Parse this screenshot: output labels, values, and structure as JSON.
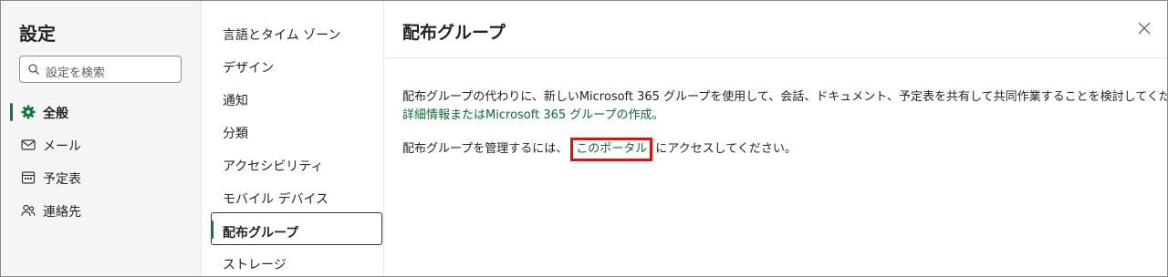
{
  "sidebar": {
    "title": "設定",
    "search_placeholder": "設定を検索",
    "items": [
      {
        "label": "全般",
        "icon": "gear-icon",
        "active": true
      },
      {
        "label": "メール",
        "icon": "mail-icon"
      },
      {
        "label": "予定表",
        "icon": "calendar-icon"
      },
      {
        "label": "連絡先",
        "icon": "people-icon"
      }
    ]
  },
  "subnav": {
    "items": [
      {
        "label": "言語とタイム ゾーン"
      },
      {
        "label": "デザイン"
      },
      {
        "label": "通知"
      },
      {
        "label": "分類"
      },
      {
        "label": "アクセシビリティ"
      },
      {
        "label": "モバイル デバイス"
      },
      {
        "label": "配布グループ",
        "active": true
      },
      {
        "label": "ストレージ"
      }
    ]
  },
  "content": {
    "title": "配布グループ",
    "para1": "配布グループの代わりに、新しいMicrosoft 365 グループを使用して、会話、ドキュメント、予定表を共有して共同作業することを検討してください。",
    "link_details": "詳細情報",
    "para2_mid": "または",
    "link_create": "Microsoft 365 グループの作成。",
    "para3_before": "配布グループを管理するには、",
    "link_portal": "このポータル",
    "para3_after": "にアクセスしてください。"
  },
  "colors": {
    "accent": "#0e7a3e",
    "link": "#0b6a33",
    "highlight": "#e01010"
  }
}
